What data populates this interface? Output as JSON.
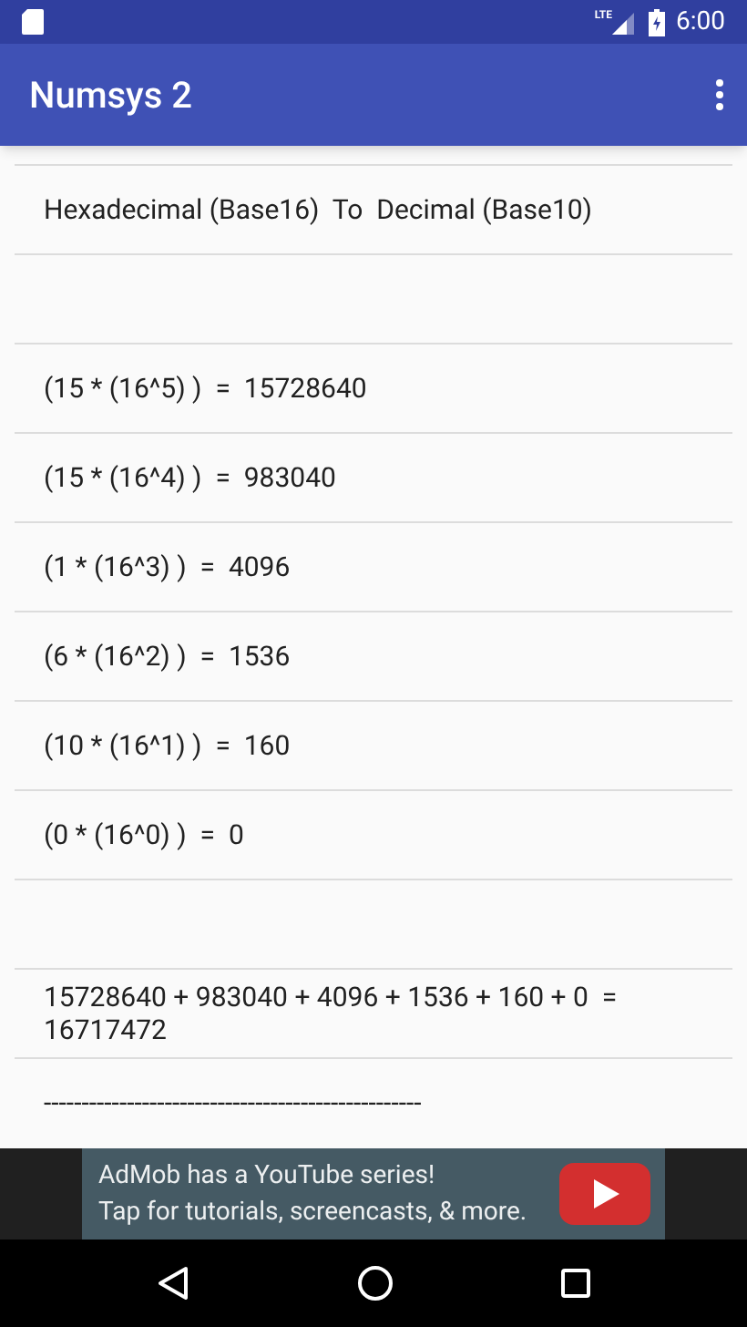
{
  "status_bar": {
    "network": "LTE",
    "time": "6:00"
  },
  "app_bar": {
    "title": "Numsys 2"
  },
  "rows": [
    {
      "kind": "text",
      "text": "Hexadecimal (Base16)  To  Decimal (Base10)"
    },
    {
      "kind": "blank"
    },
    {
      "kind": "text",
      "text": "(15 * (16^5) )  =  15728640"
    },
    {
      "kind": "text",
      "text": "(15 * (16^4) )  =  983040"
    },
    {
      "kind": "text",
      "text": "(1 * (16^3) )  =  4096"
    },
    {
      "kind": "text",
      "text": "(6 * (16^2) )  =  1536"
    },
    {
      "kind": "text",
      "text": "(10 * (16^1) )  =  160"
    },
    {
      "kind": "text",
      "text": "(0 * (16^0) )  =  0"
    },
    {
      "kind": "blank"
    },
    {
      "kind": "text",
      "text": "15728640 + 983040 + 4096 + 1536 + 160 + 0  =  16717472"
    },
    {
      "kind": "text",
      "text": "--------------------------------------------------"
    }
  ],
  "ad": {
    "line_1": "AdMob has a YouTube series!",
    "line_2": "Tap for tutorials, screencasts, & more."
  }
}
